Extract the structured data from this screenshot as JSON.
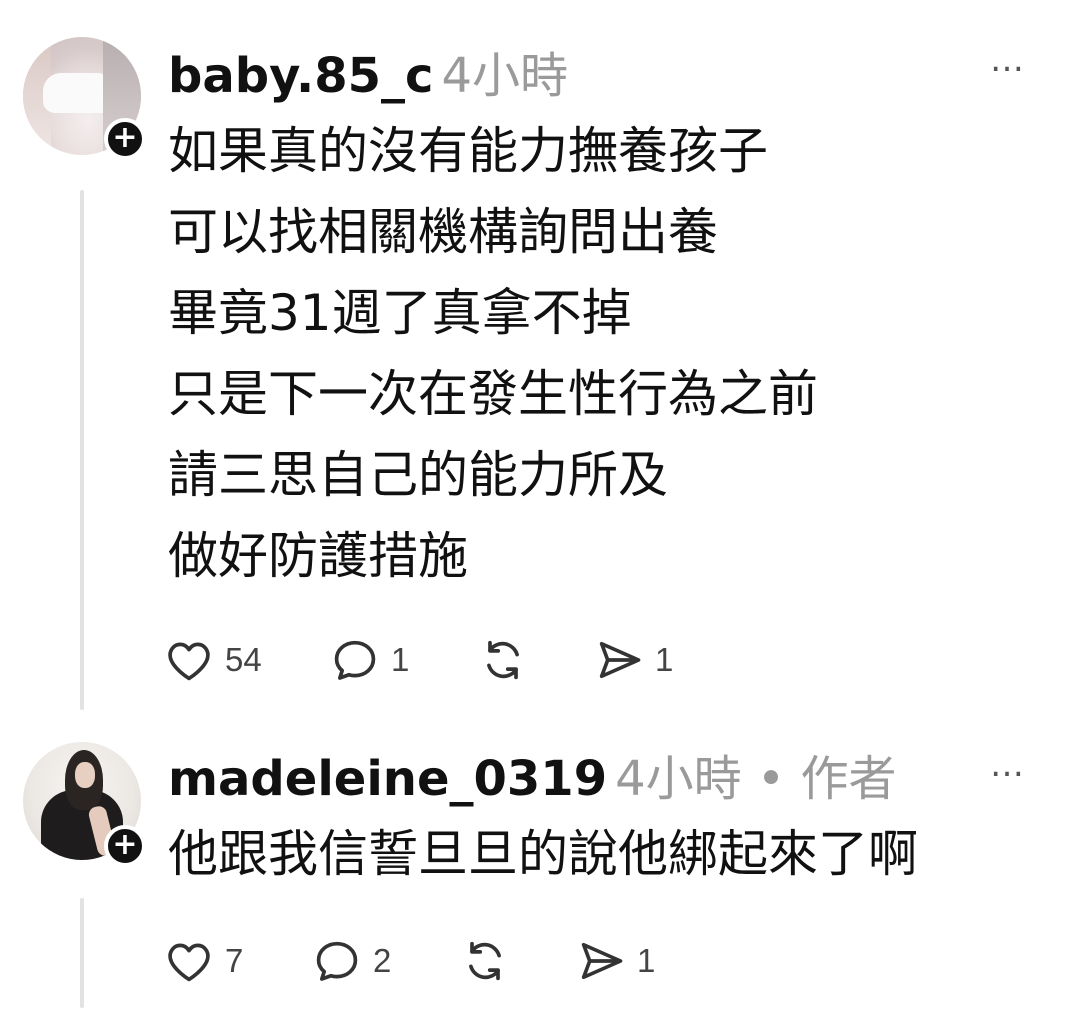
{
  "posts": [
    {
      "username": "baby.85_c",
      "meta": "4小時",
      "more": "…",
      "follow": "+",
      "body_lines": [
        "如果真的沒有能力撫養孩子",
        "可以找相關機構詢問出養",
        "畢竟31週了真拿不掉",
        "只是下一次在發生性行為之前",
        "請三思自己的能力所及",
        "做好防護措施"
      ],
      "likes": "54",
      "comments": "1",
      "reposts": "",
      "shares": "1"
    },
    {
      "username": "madeleine_0319",
      "meta": "4小時 • 作者",
      "more": "…",
      "follow": "+",
      "body_lines": [
        "他跟我信誓旦旦的說他綁起來了啊"
      ],
      "likes": "7",
      "comments": "2",
      "reposts": "",
      "shares": "1"
    }
  ],
  "icons": {
    "like": "heart-icon",
    "comment": "speech-bubble-icon",
    "repost": "repost-icon",
    "share": "send-icon",
    "more": "ellipsis-icon",
    "follow": "plus-icon"
  },
  "colors": {
    "text": "#111111",
    "meta": "#9a9a9a",
    "thread_line": "#e2e2e2",
    "icon": "#333333"
  }
}
